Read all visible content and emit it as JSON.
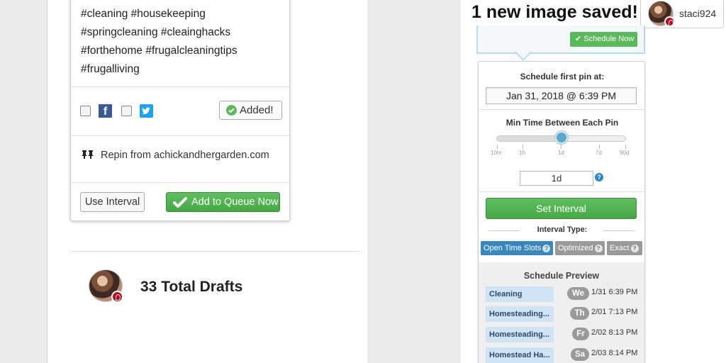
{
  "left": {
    "hashtags": [
      "#cleaning #housekeeping",
      "#springcleaning #cleainghacks",
      "#forthehome #frugalcleaningtips",
      "#frugalliving"
    ],
    "facebook_glyph": "f",
    "added_label": "Added!",
    "repin_text": "Repin from achickandhergarden.com",
    "use_interval_label": "Use Interval",
    "add_queue_label": "Add to Queue Now",
    "drafts_label": "33 Total Drafts"
  },
  "header": {
    "saved_title": "1 new image saved!",
    "username": "staci924",
    "schedule_now_label": "Schedule Now"
  },
  "schedule": {
    "first_pin_label": "Schedule first pin at:",
    "first_pin_value": "Jan 31, 2018 @ 6:39 PM",
    "min_time_label": "Min Time Between Each Pin",
    "slider_ticks": [
      "10m",
      "1h",
      "1d",
      "7d",
      "90d"
    ],
    "slider_value_fraction": 0.5,
    "interval_value": "1d",
    "help_glyph": "?",
    "set_interval_label": "Set Interval",
    "interval_type_label": "Interval Type:",
    "interval_types": [
      {
        "label": "Open Time Slots",
        "color": "#3a87bf",
        "active": true
      },
      {
        "label": "Optimized",
        "color": "#9a9a9a",
        "active": false
      },
      {
        "label": "Exact",
        "color": "#9a9a9a",
        "active": false
      }
    ],
    "preview_title": "Schedule Preview",
    "preview_rows": [
      {
        "board": "Cleaning",
        "day": "We",
        "datetime": "1/31 6:39 PM"
      },
      {
        "board": "Homesteading...",
        "day": "Th",
        "datetime": "2/01 7:13 PM"
      },
      {
        "board": "Homesteading...",
        "day": "Fr",
        "datetime": "2/02 8:13 PM"
      },
      {
        "board": "Homestead Ha...",
        "day": "Sa",
        "datetime": "2/03 8:14 PM"
      }
    ]
  },
  "colors": {
    "green": "#5cb85c",
    "blue_accent": "#3a87bf",
    "pinterest_red": "#bd081c",
    "facebook": "#3b5998",
    "twitter": "#1da1f2"
  }
}
